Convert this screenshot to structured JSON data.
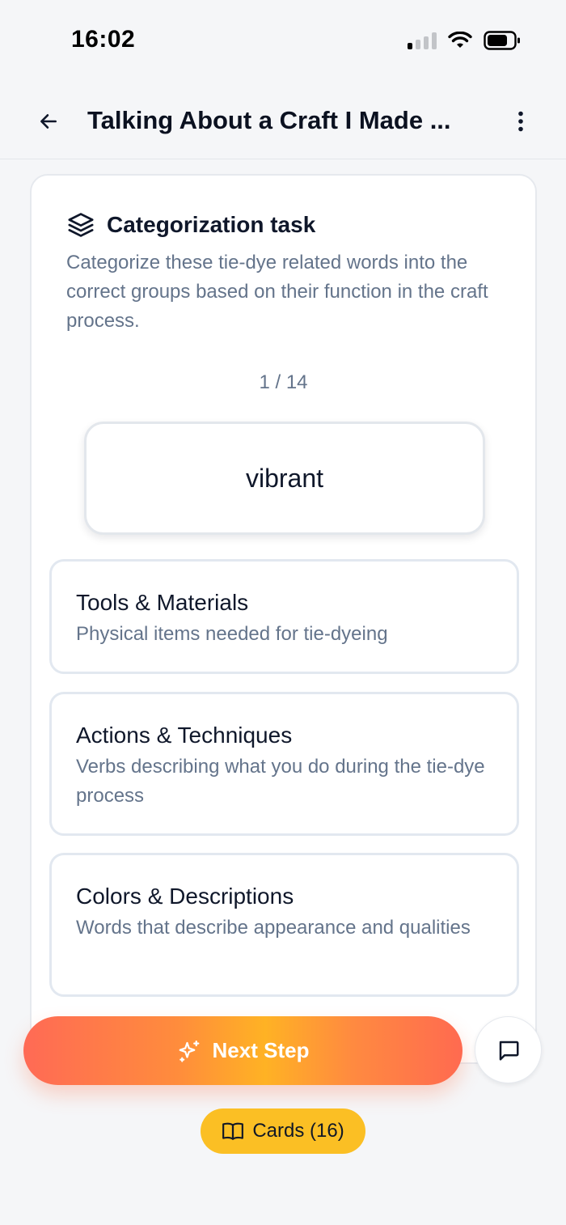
{
  "status_bar": {
    "time": "16:02"
  },
  "header": {
    "title": "Talking About a Craft I Made ..."
  },
  "task": {
    "title": "Categorization task",
    "description": "Categorize these tie-dye related words into the correct groups based on their function in the craft process.",
    "counter": "1 / 14",
    "current_word": "vibrant",
    "progress": {
      "current": 1,
      "total": 14
    }
  },
  "categories": [
    {
      "name": "Tools & Materials",
      "description": "Physical items needed for tie-dyeing"
    },
    {
      "name": "Actions & Techniques",
      "description": "Verbs describing what you do during the tie-dye process"
    },
    {
      "name": "Colors & Descriptions",
      "description": "Words that describe appearance and qualities"
    }
  ],
  "actions": {
    "next_step_label": "Next Step",
    "cards_label": "Cards (16)"
  },
  "icons": {
    "back": "arrow-left-icon",
    "more": "more-vertical-icon",
    "task": "layers-icon",
    "next": "sparkles-icon",
    "chat": "message-square-icon",
    "cards": "book-open-icon"
  },
  "colors": {
    "accent_orange": "#ff7a4f",
    "accent_yellow": "#fbbf24",
    "muted_text": "#64748b"
  }
}
